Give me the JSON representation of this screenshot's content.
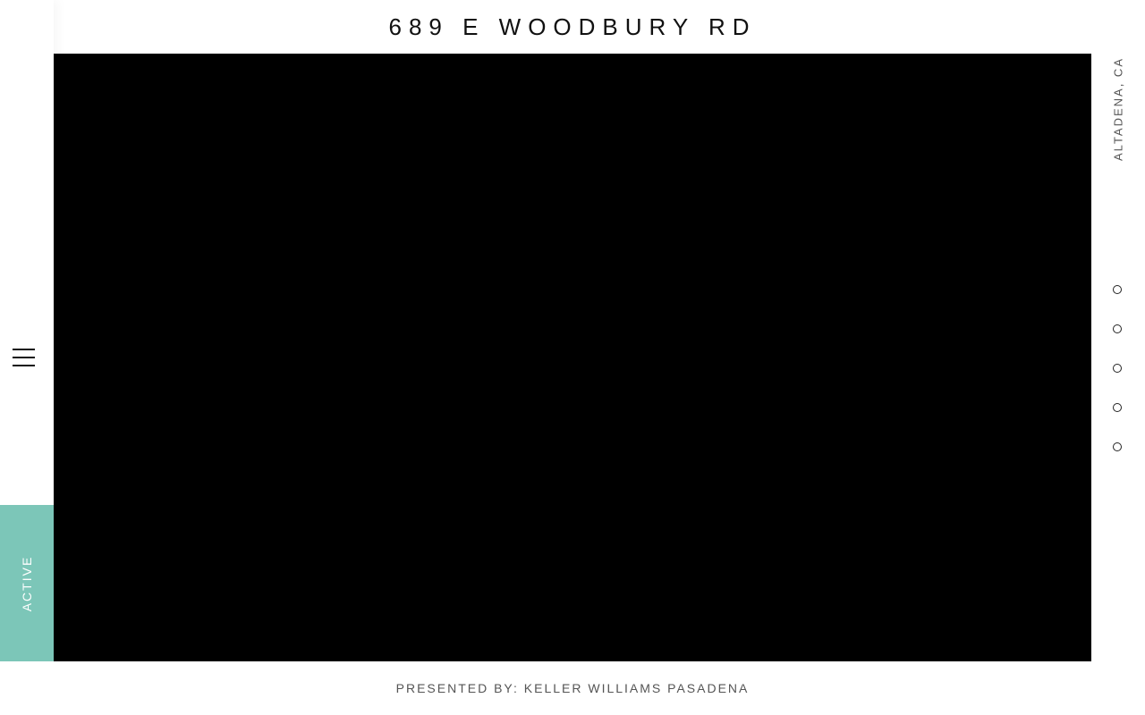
{
  "header": {
    "title": "689 E WOODBURY RD"
  },
  "sidebar_left": {
    "menu_icon": "hamburger-menu-icon",
    "status_label": "ACTIVE",
    "status_color": "#7cc6b8"
  },
  "sidebar_right": {
    "location": "ALTADENA, CA",
    "slide_count": 5
  },
  "media": {
    "background_color": "#000000"
  },
  "footer": {
    "presented_by": "PRESENTED BY: KELLER WILLIAMS PASADENA"
  }
}
